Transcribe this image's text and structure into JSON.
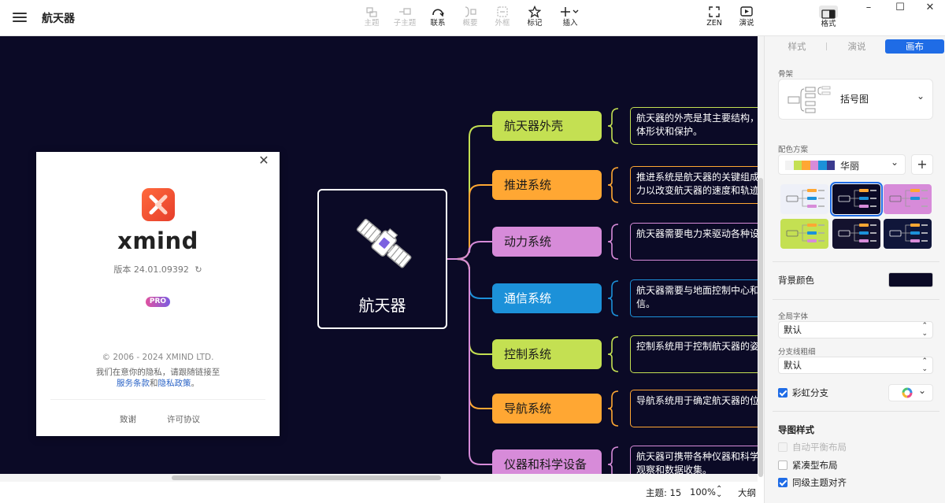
{
  "app": {
    "title": "航天器"
  },
  "toolbar": {
    "buttons": [
      {
        "id": "topic",
        "label": "主题",
        "enabled": false
      },
      {
        "id": "subtopic",
        "label": "子主题",
        "enabled": false
      },
      {
        "id": "relationship",
        "label": "联系",
        "enabled": true
      },
      {
        "id": "summary",
        "label": "概要",
        "enabled": false
      },
      {
        "id": "boundary",
        "label": "外框",
        "enabled": false
      },
      {
        "id": "marker",
        "label": "标记",
        "enabled": true
      },
      {
        "id": "insert",
        "label": "插入",
        "enabled": true
      }
    ],
    "zen_label": "ZEN",
    "pitch_label": "演说",
    "format_label": "格式"
  },
  "map": {
    "central": {
      "label": "航天器",
      "icon": "satellite-icon"
    },
    "branches": [
      {
        "label": "航天器外壳",
        "color": "#c4e052",
        "note": [
          "航天器的外壳是其主要结构，",
          "体形状和保护。"
        ]
      },
      {
        "label": "推进系统",
        "color": "#ffa733",
        "note": [
          "推进系统是航天器的关键组成",
          "力以改变航天器的速度和轨迹"
        ]
      },
      {
        "label": "动力系统",
        "color": "#d78bd9",
        "note": [
          "航天器需要电力来驱动各种设"
        ]
      },
      {
        "label": "通信系统",
        "color": "#1c91d9",
        "note": [
          "航天器需要与地面控制中心和",
          "信。"
        ]
      },
      {
        "label": "控制系统",
        "color": "#c4e052",
        "note": [
          "控制系统用于控制航天器的姿"
        ]
      },
      {
        "label": "导航系统",
        "color": "#ffa733",
        "note": [
          "导航系统用于确定航天器的位"
        ]
      },
      {
        "label": "仪器和科学设备",
        "color": "#d78bd9",
        "note": [
          "航天器可携带各种仪器和科学",
          "观察和数据收集。"
        ]
      }
    ]
  },
  "about": {
    "wordmark": "xmind",
    "version": "版本 24.01.09392",
    "badge": "PRO",
    "copyright": "© 2006 - 2024 XMIND LTD.",
    "privacy_line1": "我们在意你的隐私，请跟随链接至",
    "privacy_link_terms": "服务条款",
    "privacy_and": "和",
    "privacy_link_policy": "隐私政策",
    "privacy_end": "。",
    "thanks": "致谢",
    "license": "许可协议"
  },
  "panel": {
    "tabs": [
      "样式",
      "演说",
      "画布"
    ],
    "active_tab": "画布",
    "skeleton_label": "骨架",
    "skeleton_value": "括号图",
    "color_theme_label": "配色方案",
    "color_theme_value": "华丽",
    "palette": [
      "#f2f2f2",
      "#c4e052",
      "#ffa733",
      "#d78bd9",
      "#1c91d9",
      "#3b3b8f"
    ],
    "theme_thumbs": [
      {
        "bg": "#eef0f8",
        "selected": false
      },
      {
        "bg": "#0b0a26",
        "selected": true
      },
      {
        "bg": "#d78bd9",
        "selected": false
      },
      {
        "bg": "#c4e052",
        "selected": false
      },
      {
        "bg": "#14122e",
        "selected": false
      },
      {
        "bg": "#10163a",
        "selected": false
      }
    ],
    "bg_color_label": "背景颜色",
    "bg_color_value": "#0b0a26",
    "global_font_label": "全局字体",
    "global_font_value": "默认",
    "branch_width_label": "分支线粗细",
    "branch_width_value": "默认",
    "rainbow_label": "彩虹分支",
    "rainbow_checked": true,
    "map_style_label": "导图样式",
    "auto_balance_label": "自动平衡布局",
    "compact_label": "紧凑型布局",
    "align_label": "同级主题对齐",
    "compact_checked": false,
    "align_checked": true
  },
  "status": {
    "topic_count": "主题: 15",
    "zoom": "100%",
    "outline": "大纲"
  }
}
